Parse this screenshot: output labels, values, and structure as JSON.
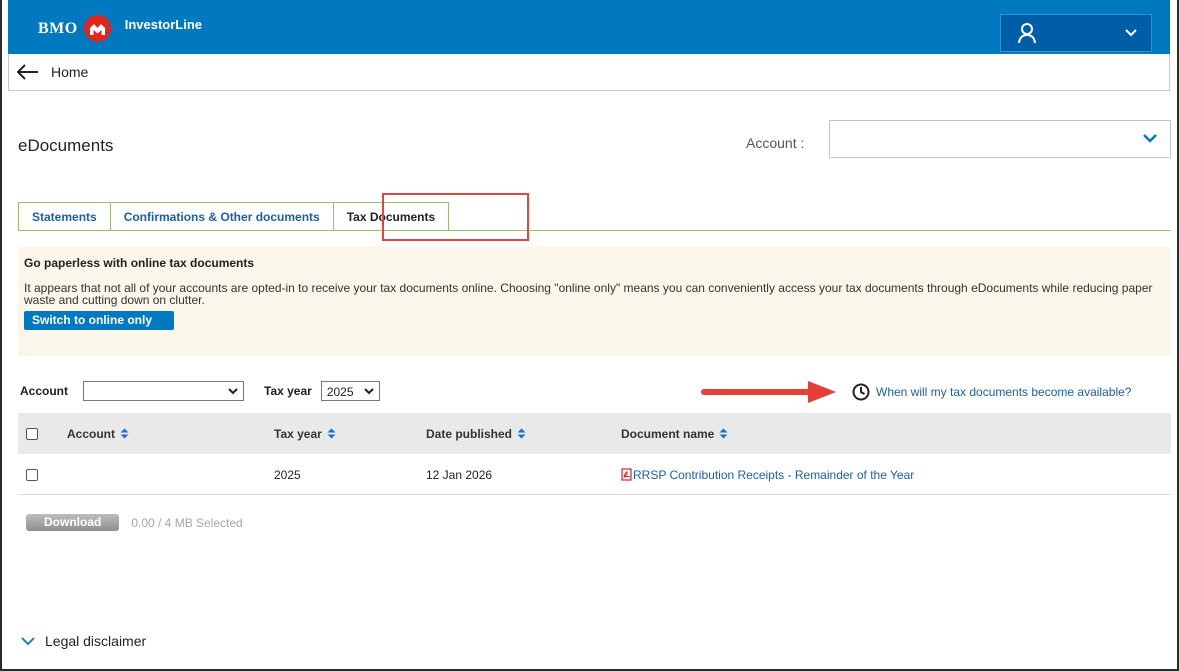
{
  "header": {
    "brand": "BMO",
    "product": "InvestorLine",
    "accent_color": "#0079c1",
    "logo_color": "#e1251b"
  },
  "nav": {
    "back_label": "Home"
  },
  "page": {
    "title": "eDocuments",
    "account_label": "Account :",
    "account_value": ""
  },
  "tabs": [
    {
      "label": "Statements",
      "active": false
    },
    {
      "label": "Confirmations & Other documents",
      "active": false
    },
    {
      "label": "Tax Documents",
      "active": true
    }
  ],
  "promo": {
    "title": "Go paperless with online tax documents",
    "text": "It appears that not all of your accounts are opted-in to receive your tax documents online. Choosing \"online only\" means you can conveniently access your tax documents through eDocuments while reducing paper waste and cutting down on clutter.",
    "button": "Switch to online only"
  },
  "filters": {
    "account_label": "Account",
    "account_value": "",
    "taxyear_label": "Tax year",
    "taxyear_value": "2025"
  },
  "availability_link": "When will my tax documents become available?",
  "table": {
    "headers": [
      "Account",
      "Tax year",
      "Date published",
      "Document name"
    ],
    "rows": [
      {
        "account": "",
        "tax_year": "2025",
        "date_published": "12 Jan 2026",
        "document_name": "RRSP Contribution Receipts - Remainder of the Year"
      }
    ]
  },
  "download": {
    "button": "Download",
    "selected": "0.00 / 4 MB Selected"
  },
  "legal": {
    "label": "Legal disclaimer"
  }
}
